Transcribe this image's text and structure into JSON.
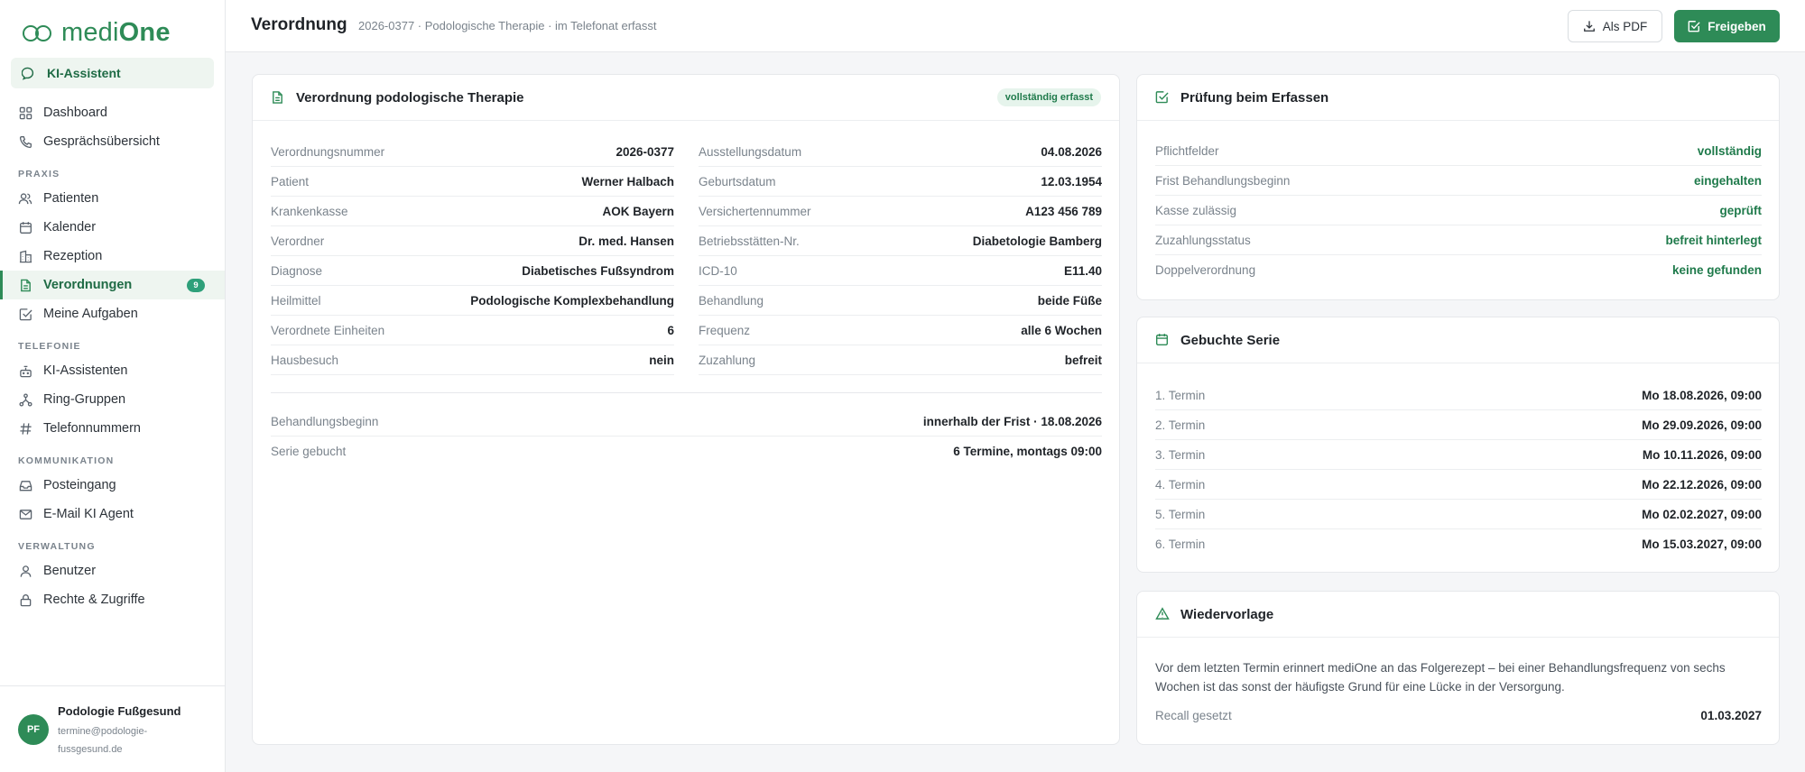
{
  "brand": {
    "name_light": "medi",
    "name_bold": "One"
  },
  "sidebar": {
    "ki_button": "KI-Assistent",
    "items_top": [
      {
        "label": "Dashboard"
      },
      {
        "label": "Gesprächsübersicht"
      }
    ],
    "sections": {
      "praxis": "PRAXIS",
      "telefonie": "TELEFONIE",
      "kommunikation": "KOMMUNIKATION",
      "verwaltung": "VERWALTUNG"
    },
    "praxis_items": [
      {
        "label": "Patienten"
      },
      {
        "label": "Kalender"
      },
      {
        "label": "Rezeption"
      },
      {
        "label": "Verordnungen",
        "badge": "9"
      },
      {
        "label": "Meine Aufgaben"
      }
    ],
    "telefonie_items": [
      {
        "label": "KI-Assistenten"
      },
      {
        "label": "Ring-Gruppen"
      },
      {
        "label": "Telefonnummern"
      }
    ],
    "kommunikation_items": [
      {
        "label": "Posteingang"
      },
      {
        "label": "E-Mail KI Agent"
      }
    ],
    "verwaltung_items": [
      {
        "label": "Benutzer"
      },
      {
        "label": "Rechte & Zugriffe"
      }
    ],
    "user": {
      "initials": "PF",
      "name": "Podologie Fußgesund",
      "email": "termine@podologie-fussgesund.de"
    }
  },
  "header": {
    "title": "Verordnung",
    "subtitle": "2026-0377 · Podologische Therapie · im Telefonat erfasst",
    "pdf_button": "Als PDF",
    "release_button": "Freigeben"
  },
  "verordnung": {
    "title": "Verordnung podologische Therapie",
    "status": "vollständig erfasst",
    "left": [
      {
        "k": "Verordnungsnummer",
        "v": "2026-0377"
      },
      {
        "k": "Patient",
        "v": "Werner Halbach"
      },
      {
        "k": "Krankenkasse",
        "v": "AOK Bayern"
      },
      {
        "k": "Verordner",
        "v": "Dr. med. Hansen"
      },
      {
        "k": "Diagnose",
        "v": "Diabetisches Fußsyndrom"
      },
      {
        "k": "Heilmittel",
        "v": "Podologische Komplexbehandlung"
      },
      {
        "k": "Verordnete Einheiten",
        "v": "6"
      },
      {
        "k": "Hausbesuch",
        "v": "nein"
      }
    ],
    "right": [
      {
        "k": "Ausstellungsdatum",
        "v": "04.08.2026"
      },
      {
        "k": "Geburtsdatum",
        "v": "12.03.1954"
      },
      {
        "k": "Versichertennummer",
        "v": "A123 456 789"
      },
      {
        "k": "Betriebsstätten-Nr.",
        "v": "Diabetologie Bamberg"
      },
      {
        "k": "ICD-10",
        "v": "E11.40"
      },
      {
        "k": "Behandlung",
        "v": "beide Füße"
      },
      {
        "k": "Frequenz",
        "v": "alle 6 Wochen"
      },
      {
        "k": "Zuzahlung",
        "v": "befreit"
      }
    ],
    "bottom": [
      {
        "k": "Behandlungsbeginn",
        "v": "innerhalb der Frist · 18.08.2026"
      },
      {
        "k": "Serie gebucht",
        "v": "6 Termine, montags 09:00"
      }
    ]
  },
  "pruefung": {
    "title": "Prüfung beim Erfassen",
    "rows": [
      {
        "k": "Pflichtfelder",
        "v": "vollständig"
      },
      {
        "k": "Frist Behandlungsbeginn",
        "v": "eingehalten"
      },
      {
        "k": "Kasse zulässig",
        "v": "geprüft"
      },
      {
        "k": "Zuzahlungsstatus",
        "v": "befreit hinterlegt"
      },
      {
        "k": "Doppelverordnung",
        "v": "keine gefunden"
      }
    ]
  },
  "serie": {
    "title": "Gebuchte Serie",
    "rows": [
      {
        "k": "1. Termin",
        "v": "Mo 18.08.2026, 09:00"
      },
      {
        "k": "2. Termin",
        "v": "Mo 29.09.2026, 09:00"
      },
      {
        "k": "3. Termin",
        "v": "Mo 10.11.2026, 09:00"
      },
      {
        "k": "4. Termin",
        "v": "Mo 22.12.2026, 09:00"
      },
      {
        "k": "5. Termin",
        "v": "Mo 02.02.2027, 09:00"
      },
      {
        "k": "6. Termin",
        "v": "Mo 15.03.2027, 09:00"
      }
    ]
  },
  "wiedervorlage": {
    "title": "Wiedervorlage",
    "text": "Vor dem letzten Termin erinnert mediOne an das Folgerezept – bei einer Behandlungsfrequenz von sechs Wochen ist das sonst der häufigste Grund für eine Lücke in der Versorgung.",
    "recall_label": "Recall gesetzt",
    "recall_value": "01.03.2027"
  },
  "colors": {
    "accent": "#2e8b57",
    "accent_light": "#eef5f0",
    "badge": "#2ea07a"
  }
}
